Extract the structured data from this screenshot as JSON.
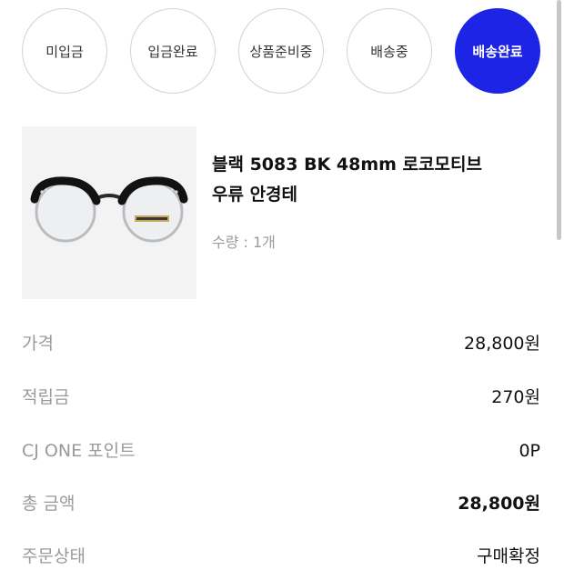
{
  "status_steps": [
    {
      "label": "미입금",
      "active": false
    },
    {
      "label": "입금완료",
      "active": false
    },
    {
      "label": "상품준비중",
      "active": false
    },
    {
      "label": "배송중",
      "active": false
    },
    {
      "label": "배송완료",
      "active": true
    }
  ],
  "product": {
    "name_line1": "블랙 5083 BK 48mm 로코모티브",
    "name_line2": "우류 안경테",
    "quantity": "수량 : 1개",
    "thumbnail_icon": "eyeglasses-icon"
  },
  "summary": [
    {
      "label": "가격",
      "value": "28,800원",
      "emphasis": false
    },
    {
      "label": "적립금",
      "value": "270원",
      "emphasis": false
    },
    {
      "label": "CJ ONE 포인트",
      "value": "0P",
      "emphasis": false
    },
    {
      "label": "총 금액",
      "value": "28,800원",
      "emphasis": true
    },
    {
      "label": "주문상태",
      "value": "구매확정",
      "emphasis": false
    }
  ],
  "colors": {
    "accent": "#1d24e6",
    "muted_text": "#9a9a9a",
    "thumb_bg": "#f3f3f3"
  }
}
